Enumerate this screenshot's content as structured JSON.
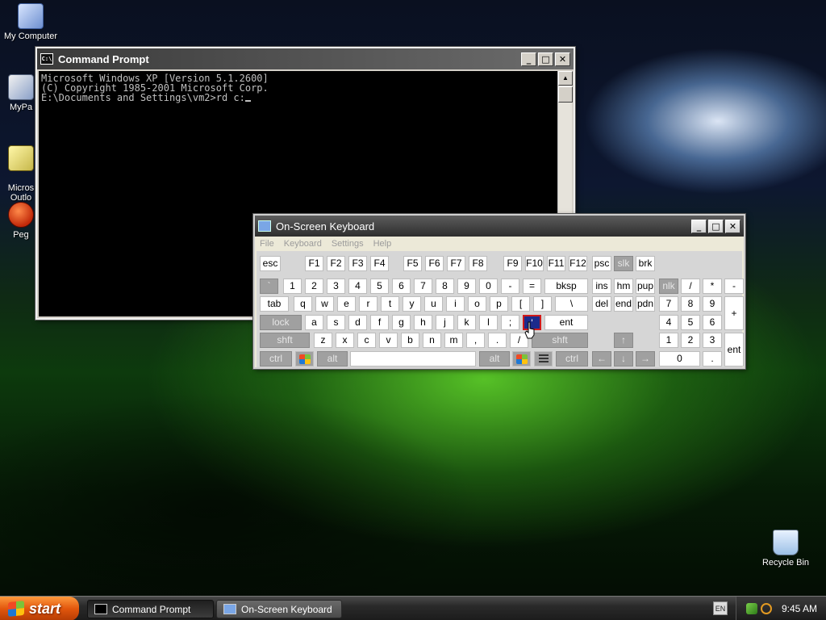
{
  "desktop": {
    "icons": [
      {
        "label": "My Computer",
        "icon": "computer-icon"
      },
      {
        "label": "MyPa",
        "icon": "documents-icon"
      },
      {
        "label": "Micros\nOutlo",
        "icon": "outlook-icon"
      },
      {
        "label": "Peg",
        "icon": "app-icon"
      },
      {
        "label": "Recycle Bin",
        "icon": "recycle-bin-icon"
      }
    ]
  },
  "cmd": {
    "title": "Command Prompt",
    "icon_text": "C:\\",
    "lines": [
      "Microsoft Windows XP [Version 5.1.2600]",
      "(C) Copyright 1985-2001 Microsoft Corp.",
      "",
      "E:\\Documents and Settings\\vm2>rd c:"
    ]
  },
  "osk": {
    "title": "On-Screen Keyboard",
    "menu": [
      "File",
      "Keyboard",
      "Settings",
      "Help"
    ],
    "keys": {
      "esc": "esc",
      "f1": "F1",
      "f2": "F2",
      "f3": "F3",
      "f4": "F4",
      "f5": "F5",
      "f6": "F6",
      "f7": "F7",
      "f8": "F8",
      "f9": "F9",
      "f10": "F10",
      "f11": "F11",
      "f12": "F12",
      "psc": "psc",
      "slk": "slk",
      "brk": "brk",
      "tick": "`",
      "n1": "1",
      "n2": "2",
      "n3": "3",
      "n4": "4",
      "n5": "5",
      "n6": "6",
      "n7": "7",
      "n8": "8",
      "n9": "9",
      "n0": "0",
      "minus": "-",
      "equals": "=",
      "bksp": "bksp",
      "ins": "ins",
      "hm": "hm",
      "pup": "pup",
      "nlk": "nlk",
      "np_div": "/",
      "np_mul": "*",
      "np_minus": "-",
      "tab": "tab",
      "q": "q",
      "w": "w",
      "e": "e",
      "r": "r",
      "t": "t",
      "y": "y",
      "u": "u",
      "i": "i",
      "o": "o",
      "p": "p",
      "lbracket": "[",
      "rbracket": "]",
      "backslash": "\\",
      "del": "del",
      "end": "end",
      "pdn": "pdn",
      "np7": "7",
      "np8": "8",
      "np9": "9",
      "np_plus": "+",
      "lock": "lock",
      "a": "a",
      "s": "s",
      "d": "d",
      "f": "f",
      "g": "g",
      "h": "h",
      "j": "j",
      "k": "k",
      "l": "l",
      "semicolon": ";",
      "quote": "'",
      "ent": "ent",
      "np4": "4",
      "np5": "5",
      "np6": "6",
      "lshft": "shft",
      "z": "z",
      "x": "x",
      "c": "c",
      "v": "v",
      "b": "b",
      "n": "n",
      "m": "m",
      "comma": ",",
      "period": ".",
      "slash": "/",
      "rshft": "shft",
      "np1": "1",
      "np2": "2",
      "np3": "3",
      "np_ent": "ent",
      "lctrl": "ctrl",
      "lalt": "alt",
      "ralt": "alt",
      "rctrl": "ctrl",
      "up": "↑",
      "left": "←",
      "down": "↓",
      "right": "→",
      "np0": "0",
      "np_dot": "."
    }
  },
  "taskbar": {
    "start_label": "start",
    "buttons": [
      {
        "label": "Command Prompt",
        "icon": "cmd-icon"
      },
      {
        "label": "On-Screen Keyboard",
        "icon": "keyboard-icon"
      }
    ],
    "lang": "EN",
    "clock": "9:45 AM"
  }
}
